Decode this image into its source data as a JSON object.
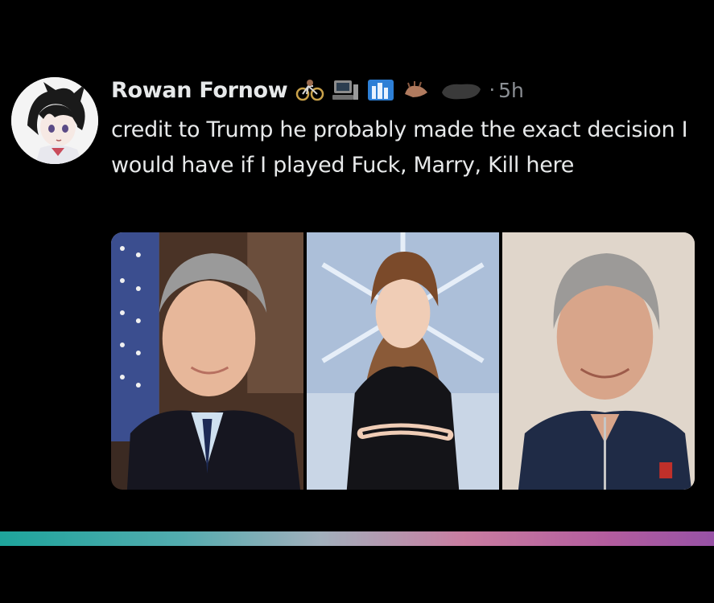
{
  "post": {
    "author": "Rowan Fornow",
    "separator": "·",
    "time": "5h",
    "text": "credit to Trump he probably made the exact decision I would have if I played Fuck, Marry, Kill here",
    "header_icons": [
      "bicycle-emoji",
      "computer-emoji",
      "city-emoji",
      "hand-emoji",
      "redacted-emoji"
    ]
  },
  "colors": {
    "background": "#000000",
    "text": "#e7e9ea",
    "muted": "#8b8f94",
    "divider_start": "#21b7ad",
    "divider_end": "#a85bb8"
  },
  "media": {
    "panels": [
      "left-portrait-photo",
      "middle-portrait-photo",
      "right-portrait-photo"
    ]
  }
}
